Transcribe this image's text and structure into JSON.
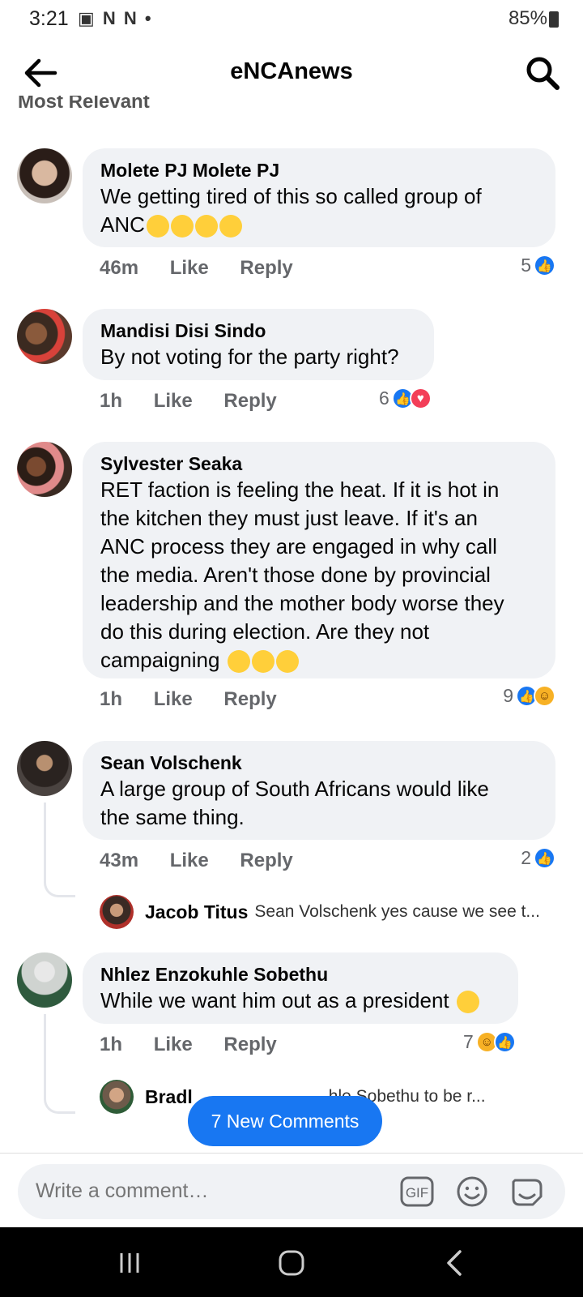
{
  "status": {
    "time": "3:21",
    "battery": "85%"
  },
  "header": {
    "title": "eNCAnews",
    "sort_label": "Most Relevant"
  },
  "comments": [
    {
      "name": "Molete PJ Molete PJ",
      "text_lines": [
        "We getting tired of this so called group of",
        "ANC"
      ],
      "emoji_count": 4,
      "time": "46m",
      "like": "Like",
      "reply": "Reply",
      "reactions": "5"
    },
    {
      "name": "Mandisi Disi Sindo",
      "text_lines": [
        "By not voting for the party right?"
      ],
      "time": "1h",
      "like": "Like",
      "reply": "Reply",
      "reactions": "6"
    },
    {
      "name": "Sylvester Seaka",
      "text_lines": [
        "RET faction is feeling the heat. If it is hot in",
        "the kitchen they must just leave. If it's an",
        "ANC process they are engaged in why call",
        "the media. Aren't those done by provincial",
        "leadership and the mother body worse they",
        "do this during election. Are they not",
        "campaigning "
      ],
      "time": "1h",
      "like": "Like",
      "reply": "Reply",
      "reactions": "9"
    },
    {
      "name": "Sean Volschenk",
      "text_lines": [
        "A large group of South Africans would like",
        "the same thing."
      ],
      "time": "43m",
      "like": "Like",
      "reply": "Reply",
      "reactions": "2",
      "reply_preview": {
        "name": "Jacob Titus",
        "text": "Sean Volschenk yes cause we see t..."
      }
    },
    {
      "name": "Nhlez Enzokuhle Sobethu",
      "text_lines": [
        "While we want him out as a president "
      ],
      "time": "1h",
      "like": "Like",
      "reply": "Reply",
      "reactions": "7",
      "reply_preview": {
        "name": "Bradl",
        "text": "hle Sobethu to be r..."
      }
    }
  ],
  "new_comments_label": "7 New Comments",
  "composer": {
    "placeholder": "Write a comment…",
    "gif_label": "GIF"
  },
  "colors": {
    "accent": "#1877f2",
    "bubble": "#f0f2f5",
    "heart": "#f33e58",
    "haha": "#f7b125"
  }
}
